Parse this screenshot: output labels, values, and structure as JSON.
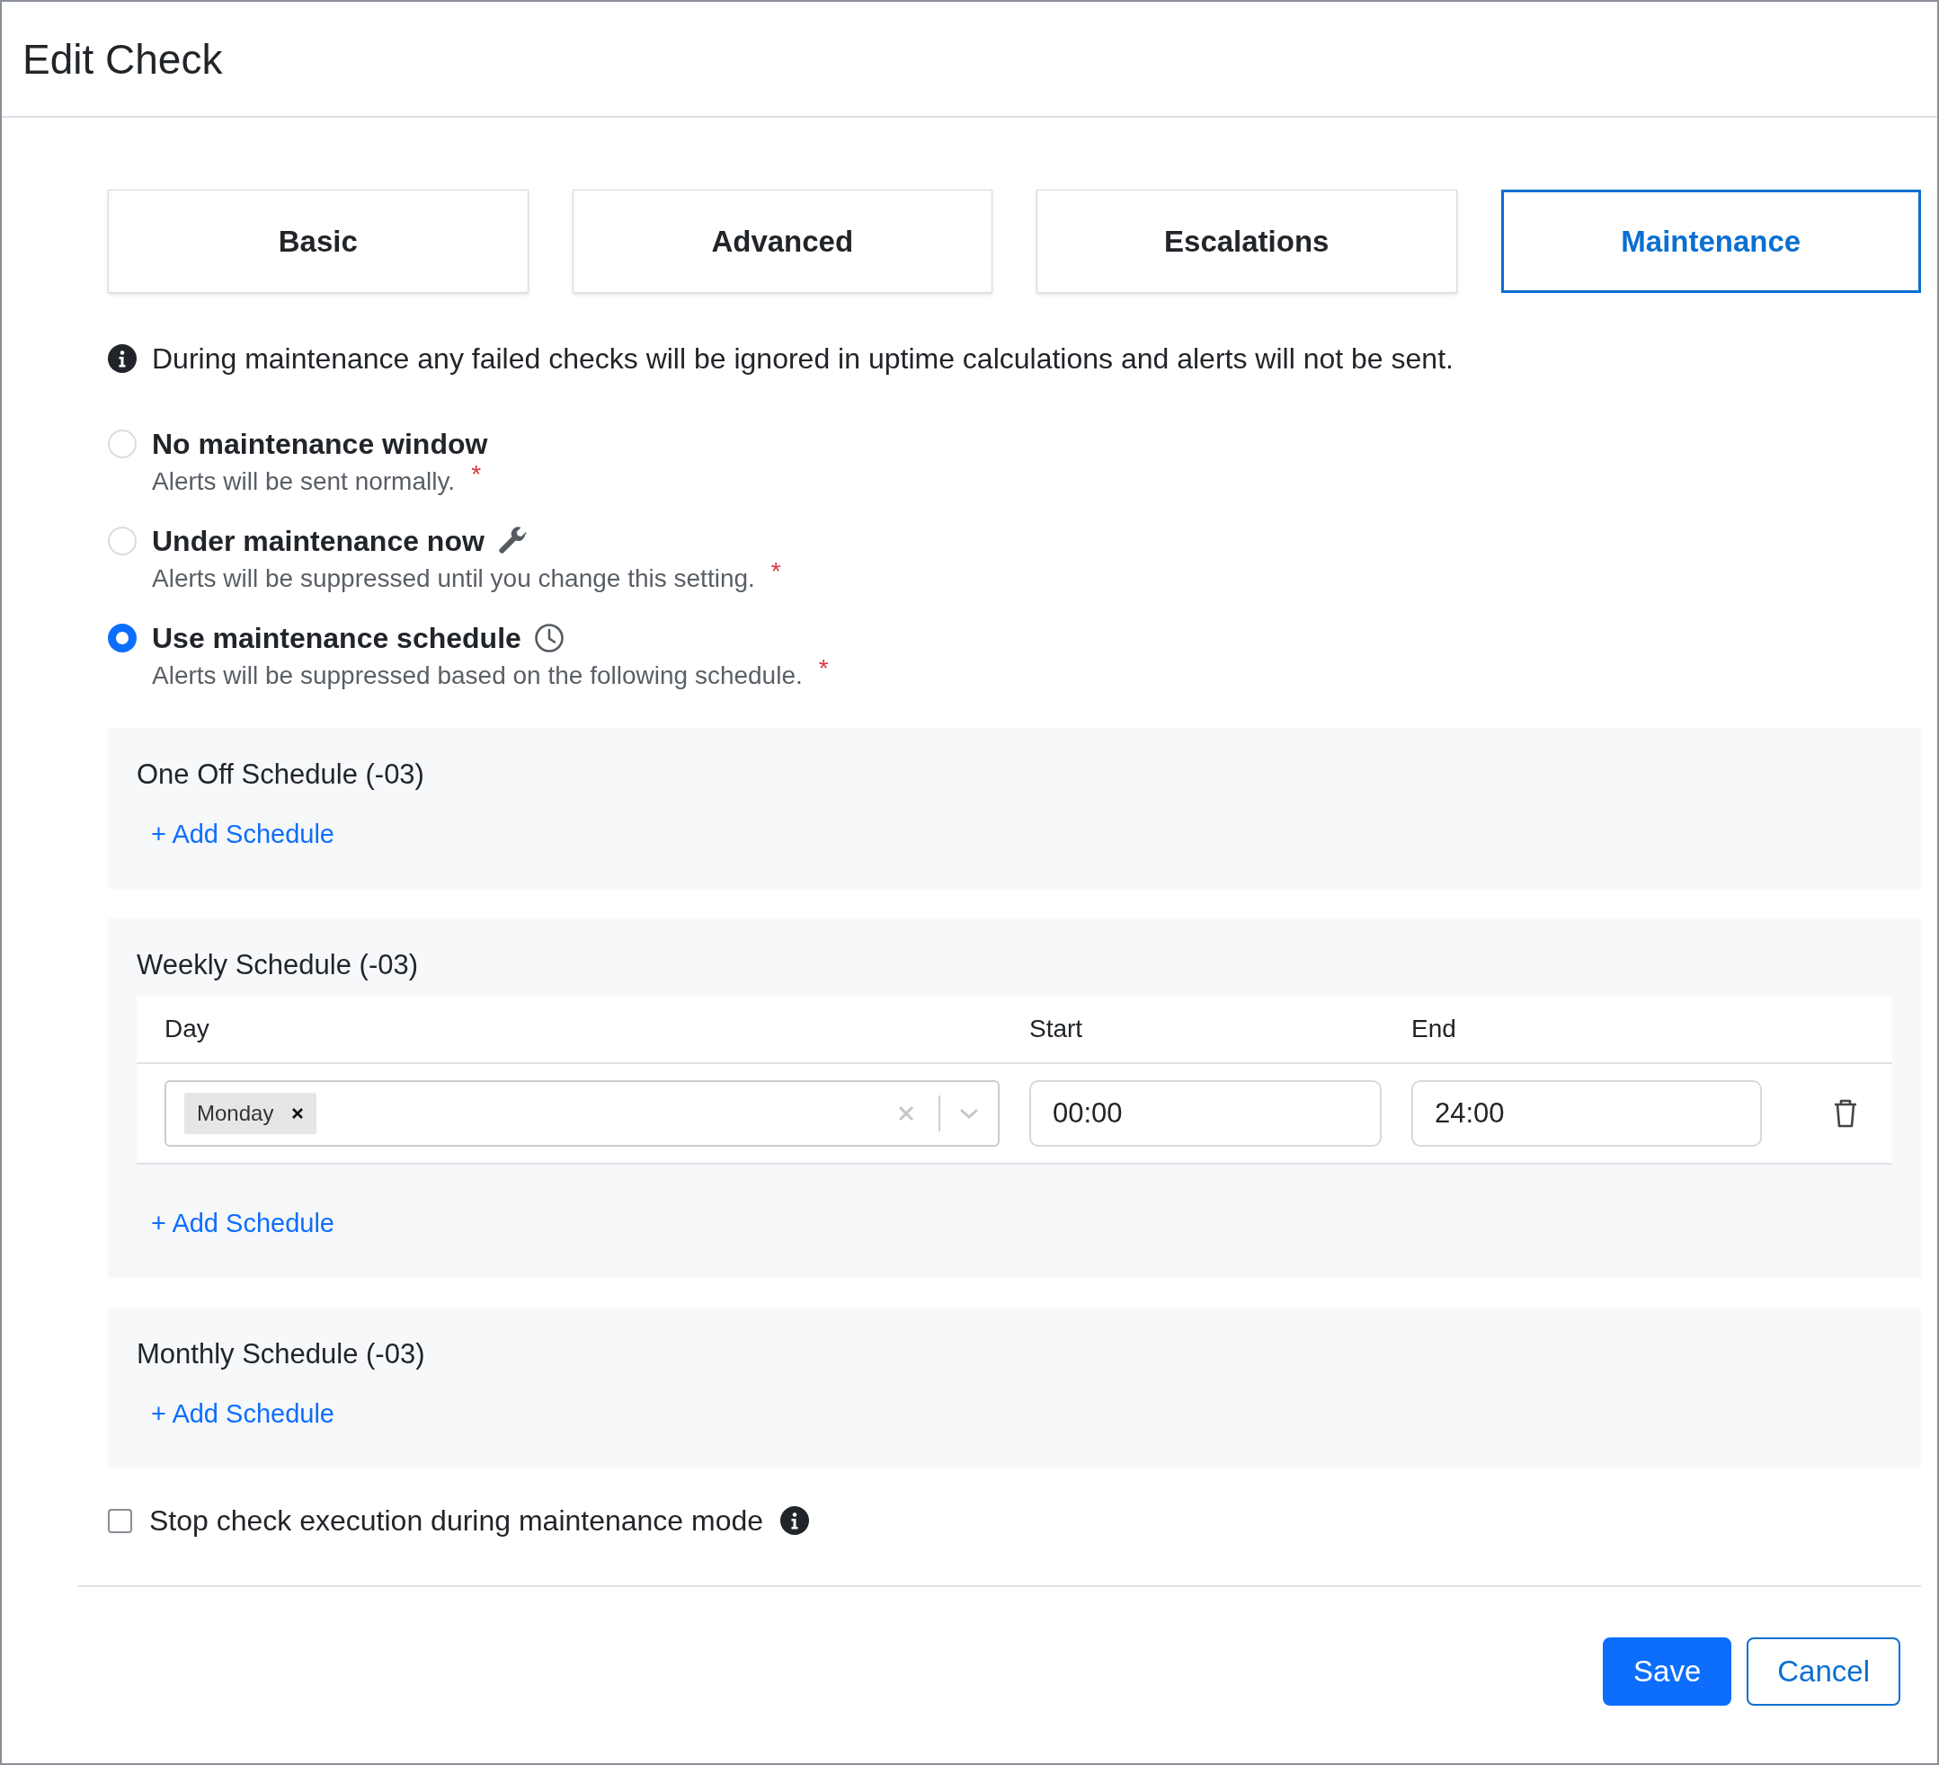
{
  "title": "Edit Check",
  "tabs": [
    {
      "label": "Basic",
      "selected": false
    },
    {
      "label": "Advanced",
      "selected": false
    },
    {
      "label": "Escalations",
      "selected": false
    },
    {
      "label": "Maintenance",
      "selected": true
    }
  ],
  "info": "During maintenance any failed checks will be ignored in uptime calculations and alerts will not be sent.",
  "options": [
    {
      "label": "No maintenance window",
      "description": "Alerts will be sent normally.",
      "required_mark": "*",
      "selected": false
    },
    {
      "label": "Under maintenance now",
      "description": "Alerts will be suppressed until you change this setting.",
      "required_mark": "*",
      "selected": false
    },
    {
      "label": "Use maintenance schedule",
      "description": "Alerts will be suppressed based on the following schedule.",
      "required_mark": "*",
      "selected": true
    }
  ],
  "sections": [
    {
      "kind": "list",
      "title": "One Off Schedule (-03)",
      "add_label": "+ Add Schedule"
    },
    {
      "kind": "table",
      "title": "Weekly Schedule (-03)",
      "columns": [
        "Day",
        "Start",
        "End"
      ],
      "rows": [
        {
          "days": [
            "Monday"
          ],
          "start": "00:00",
          "end": "24:00"
        }
      ],
      "add_label": "+ Add Schedule"
    },
    {
      "kind": "list",
      "title": "Monthly Schedule (-03)",
      "add_label": "+ Add Schedule"
    }
  ],
  "stop_check": {
    "label": "Stop check execution during maintenance mode",
    "checked": false
  },
  "buttons": {
    "save": "Save",
    "cancel": "Cancel"
  }
}
